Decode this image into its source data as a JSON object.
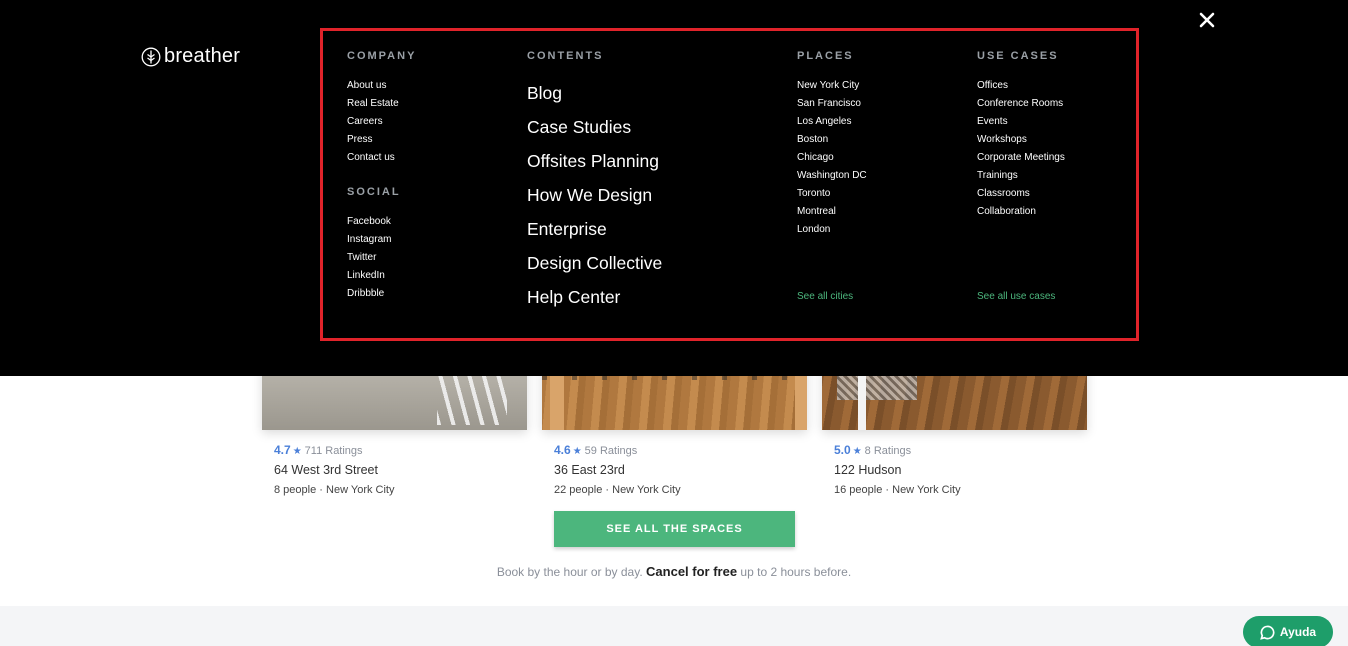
{
  "colors": {
    "accent_green": "#4cb67d",
    "rating_blue": "#4a7fd8",
    "highlight_border": "#e0232a",
    "overlay_bg": "#000000"
  },
  "logo": {
    "text": "breather",
    "icon": "breather-logo-icon"
  },
  "close": {
    "icon": "close-icon"
  },
  "menu": {
    "company": {
      "heading": "COMPANY",
      "items": [
        "About us",
        "Real Estate",
        "Careers",
        "Press",
        "Contact us"
      ]
    },
    "social": {
      "heading": "SOCIAL",
      "items": [
        "Facebook",
        "Instagram",
        "Twitter",
        "LinkedIn",
        "Dribbble"
      ]
    },
    "contents": {
      "heading": "CONTENTS",
      "items": [
        "Blog",
        "Case Studies",
        "Offsites Planning",
        "How We Design",
        "Enterprise",
        "Design Collective",
        "Help Center"
      ]
    },
    "places": {
      "heading": "PLACES",
      "items": [
        "New York City",
        "San Francisco",
        "Los Angeles",
        "Boston",
        "Chicago",
        "Washington DC",
        "Toronto",
        "Montreal",
        "London"
      ],
      "see_all": "See all cities"
    },
    "use_cases": {
      "heading": "USE CASES",
      "items": [
        "Offices",
        "Conference Rooms",
        "Events",
        "Workshops",
        "Corporate Meetings",
        "Trainings",
        "Classrooms",
        "Collaboration"
      ],
      "see_all": "See all use cases"
    }
  },
  "spaces": [
    {
      "rating": "4.7",
      "ratings_count": "711 Ratings",
      "address": "64 West 3rd Street",
      "people": "8 people",
      "city": "New York City"
    },
    {
      "rating": "4.6",
      "ratings_count": "59 Ratings",
      "address": "36 East 23rd",
      "people": "22 people",
      "city": "New York City"
    },
    {
      "rating": "5.0",
      "ratings_count": "8 Ratings",
      "address": "122 Hudson",
      "people": "16 people",
      "city": "New York City"
    }
  ],
  "separator": "·",
  "see_all_spaces": "SEE ALL THE SPACES",
  "booking": {
    "prefix": "Book by the hour or by day.",
    "bold": "Cancel for free",
    "suffix": "up to 2 hours before."
  },
  "help": {
    "label": "Ayuda",
    "icon": "chat-bubble-icon"
  }
}
